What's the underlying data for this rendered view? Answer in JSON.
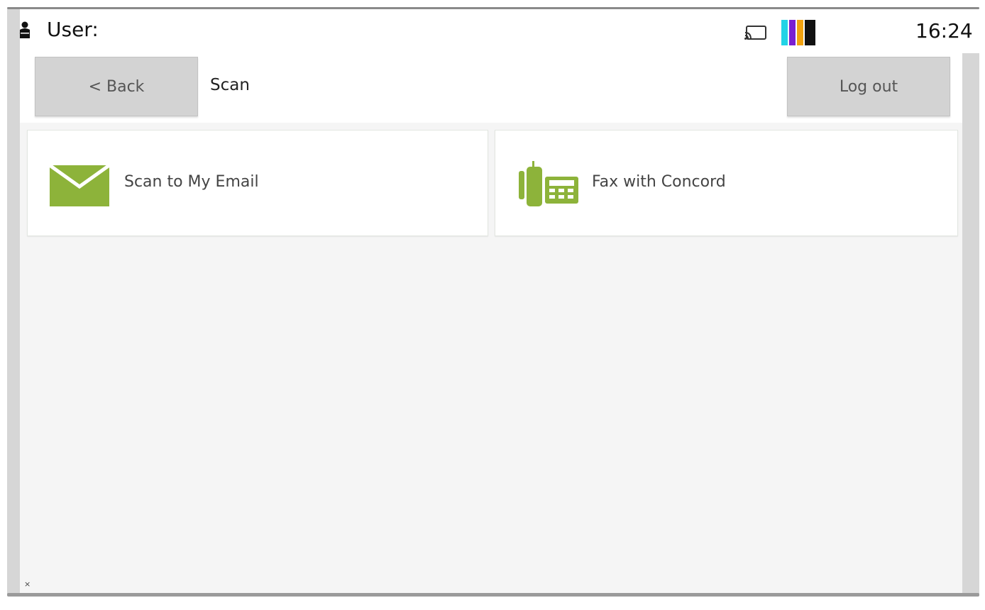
{
  "status_bar": {
    "user_label": "User:",
    "time": "16:24",
    "icons": [
      "user-icon",
      "cast-icon",
      "toner-level-icon"
    ],
    "toner_colors": [
      "#22d3e6",
      "#7a1fd1",
      "#f2a20f",
      "#111111"
    ]
  },
  "header": {
    "back_label": "< Back",
    "title": "Scan",
    "logout_label": "Log out"
  },
  "tiles": [
    {
      "label": "Scan to My Email",
      "icon": "email-icon"
    },
    {
      "label": "Fax with Concord",
      "icon": "fax-icon"
    }
  ],
  "footer": {
    "close_glyph": "×"
  },
  "colors": {
    "accent_green": "#8db33a",
    "button_gray": "#d3d3d3",
    "content_bg": "#f5f5f5"
  }
}
